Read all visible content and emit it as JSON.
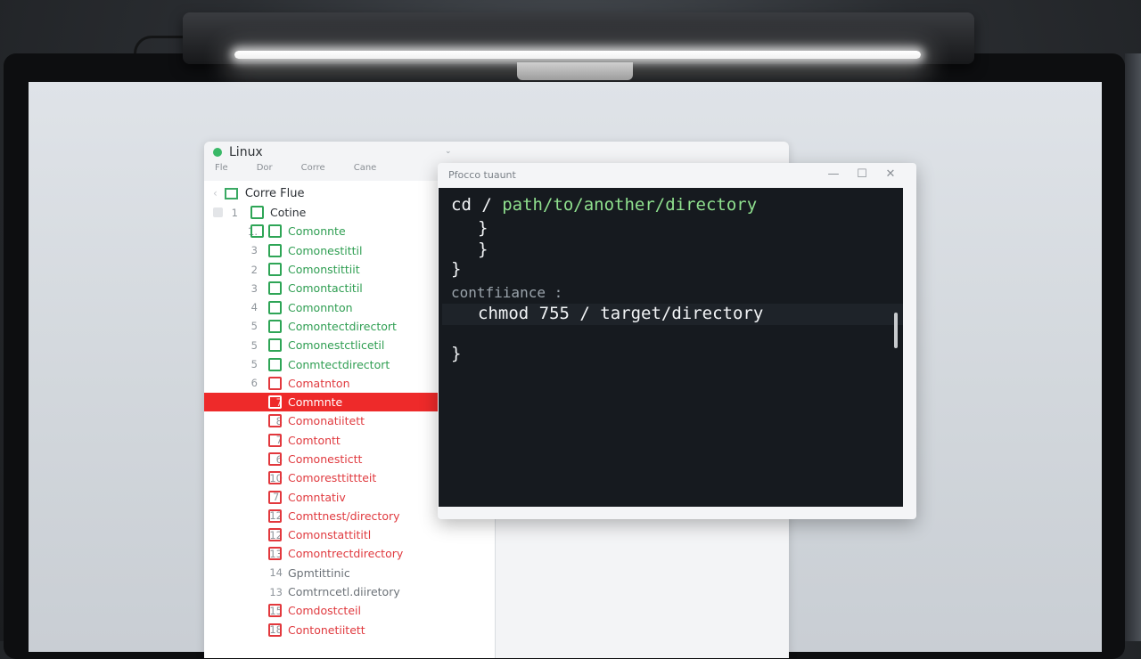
{
  "file_manager": {
    "title": "Linux",
    "menu": [
      "Fle",
      "Dor",
      "Corre",
      "Cane"
    ],
    "header": "Corre Flue",
    "rows": [
      {
        "num": "1",
        "label": "Cotine",
        "color": "dark"
      },
      {
        "num": "1.",
        "label": "Comonnte",
        "color": "green"
      },
      {
        "num": "3",
        "label": "Comonestittil",
        "color": "green"
      },
      {
        "num": "2",
        "label": "Comonstittiit",
        "color": "green"
      },
      {
        "num": "3",
        "label": "Comontactitil",
        "color": "green"
      },
      {
        "num": "4",
        "label": "Comonnton",
        "color": "green"
      },
      {
        "num": "5",
        "label": "Comontectdirectort",
        "color": "green"
      },
      {
        "num": "5",
        "label": "Comonestctlicetil",
        "color": "green"
      },
      {
        "num": "5",
        "label": "Conmtectdirectort",
        "color": "green"
      },
      {
        "num": "6",
        "label": "Comatnton",
        "color": "red"
      },
      {
        "num": "7",
        "label": "Commnte",
        "color": "selected"
      },
      {
        "num": "8",
        "label": "Comonatiitett",
        "color": "red"
      },
      {
        "num": "7",
        "label": "Comtontt",
        "color": "red"
      },
      {
        "num": "6",
        "label": "Comonestictt",
        "color": "red"
      },
      {
        "num": "10",
        "label": "Comoresttittteit",
        "color": "red"
      },
      {
        "num": "7.",
        "label": "Comntativ",
        "color": "red"
      },
      {
        "num": "12",
        "label": "Comttnest/directory",
        "color": "red"
      },
      {
        "num": "12",
        "label": "Comonstattititl",
        "color": "red"
      },
      {
        "num": "13",
        "label": "Comontrectdirectory",
        "color": "red"
      },
      {
        "num": "14",
        "label": "Gpmtittinic",
        "color": "gray"
      },
      {
        "num": "13",
        "label": "Comtrncetl.diiretory",
        "color": "gray"
      },
      {
        "num": "15",
        "label": "Comdostcteil",
        "color": "red"
      },
      {
        "num": "18",
        "label": "Contonetiitett",
        "color": "red"
      }
    ]
  },
  "terminal": {
    "title": "Pfocco tuaunt",
    "buttons": {
      "minimize": "—",
      "maximize": "☐",
      "close": "✕"
    },
    "lines": {
      "cmd1_prefix": "cd / ",
      "cmd1_path": "path/to/another/directory",
      "brace1": "}",
      "brace2": "}",
      "brace3": "}",
      "label": "contfiiance :",
      "cmd2": "chmod 755 / target/directory",
      "brace4": "}"
    }
  }
}
